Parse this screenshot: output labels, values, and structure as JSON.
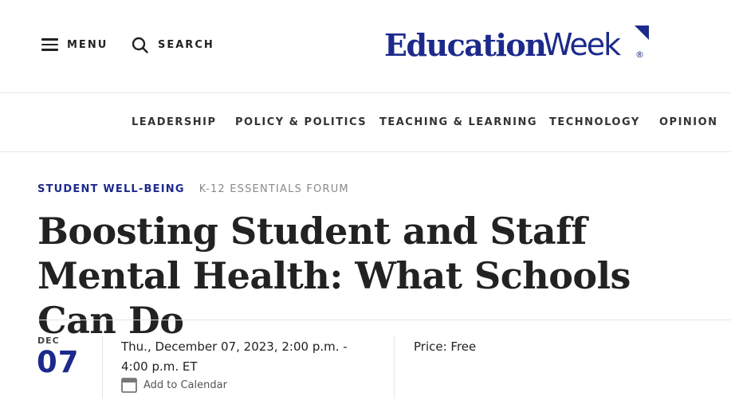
{
  "header": {
    "menu_label": "MENU",
    "search_label": "SEARCH",
    "logo": {
      "part1": "Education",
      "part2": "Week",
      "reg": "®"
    }
  },
  "nav": {
    "items": [
      {
        "label": "LEADERSHIP"
      },
      {
        "label": "POLICY & POLITICS"
      },
      {
        "label": "TEACHING & LEARNING"
      },
      {
        "label": "TECHNOLOGY"
      },
      {
        "label": "OPINION"
      }
    ]
  },
  "article": {
    "category": "STUDENT WELL-BEING",
    "series": "K-12 ESSENTIALS FORUM",
    "title": "Boosting Student and Staff Mental Health: What Schools Can Do"
  },
  "event": {
    "month": "DEC",
    "day": "07",
    "time": "Thu., December 07, 2023, 2:00 p.m. - 4:00 p.m. ET",
    "add_to_calendar": "Add to Calendar",
    "price": "Price: Free"
  },
  "colors": {
    "brand": "#1c2a8c",
    "text": "#222222",
    "muted": "#8a8a8a",
    "divider": "#e4e4e4"
  },
  "icons": {
    "menu": "hamburger-icon",
    "search": "search-icon",
    "calendar": "calendar-icon"
  }
}
